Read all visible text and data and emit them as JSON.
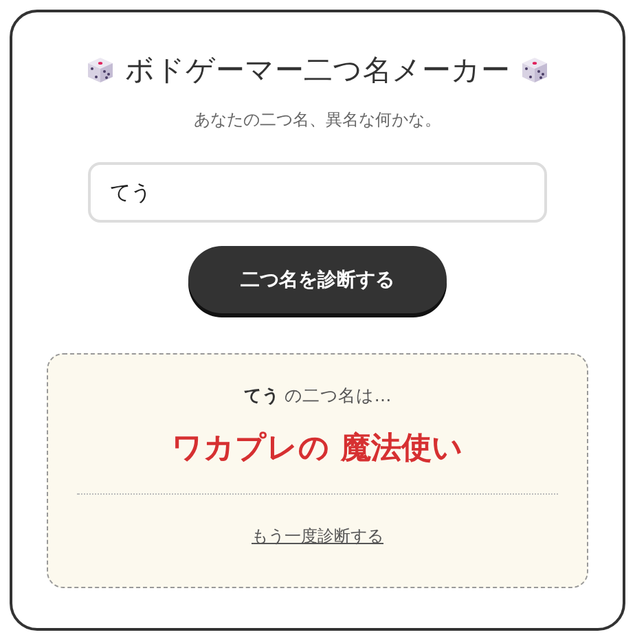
{
  "title": "ボドゲーマー二つ名メーカー",
  "subtitle": "あなたの二つ名、異名な何かな。",
  "name_field": {
    "value": "てう"
  },
  "submit_button": "二つ名を診断する",
  "result": {
    "intro": "**てう** の二つ名は…",
    "epithet": "ワカプレの 魔法使い",
    "retry_link": "もう一度診断する"
  }
}
